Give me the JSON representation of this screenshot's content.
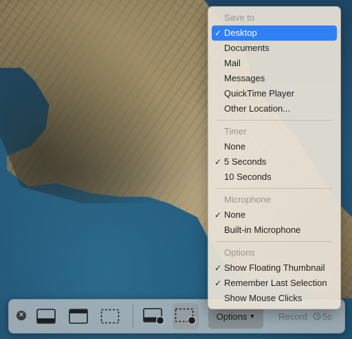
{
  "toolbar": {
    "options_label": "Options",
    "record_label": "Record",
    "timer_value": "5s"
  },
  "menu": {
    "save_to": {
      "header": "Save to",
      "items": [
        {
          "label": "Desktop",
          "checked": true,
          "highlighted": true
        },
        {
          "label": "Documents",
          "checked": false
        },
        {
          "label": "Mail",
          "checked": false
        },
        {
          "label": "Messages",
          "checked": false
        },
        {
          "label": "QuickTime Player",
          "checked": false
        },
        {
          "label": "Other Location...",
          "checked": false
        }
      ]
    },
    "timer": {
      "header": "Timer",
      "items": [
        {
          "label": "None",
          "checked": false
        },
        {
          "label": "5 Seconds",
          "checked": true
        },
        {
          "label": "10 Seconds",
          "checked": false
        }
      ]
    },
    "microphone": {
      "header": "Microphone",
      "items": [
        {
          "label": "None",
          "checked": true
        },
        {
          "label": "Built-in Microphone",
          "checked": false
        }
      ]
    },
    "options": {
      "header": "Options",
      "items": [
        {
          "label": "Show Floating Thumbnail",
          "checked": true
        },
        {
          "label": "Remember Last Selection",
          "checked": true
        },
        {
          "label": "Show Mouse Clicks",
          "checked": false
        }
      ]
    }
  },
  "colors": {
    "highlight": "#2f7ff5",
    "menu_bg": "#e8e2d6",
    "toolbar_bg": "#c8c8c8"
  },
  "icons": [
    "close-icon",
    "capture-entire-screen-icon",
    "capture-window-icon",
    "capture-selection-icon",
    "record-entire-screen-icon",
    "record-selection-icon",
    "timer-icon",
    "checkmark-icon",
    "chevron-down-icon"
  ]
}
